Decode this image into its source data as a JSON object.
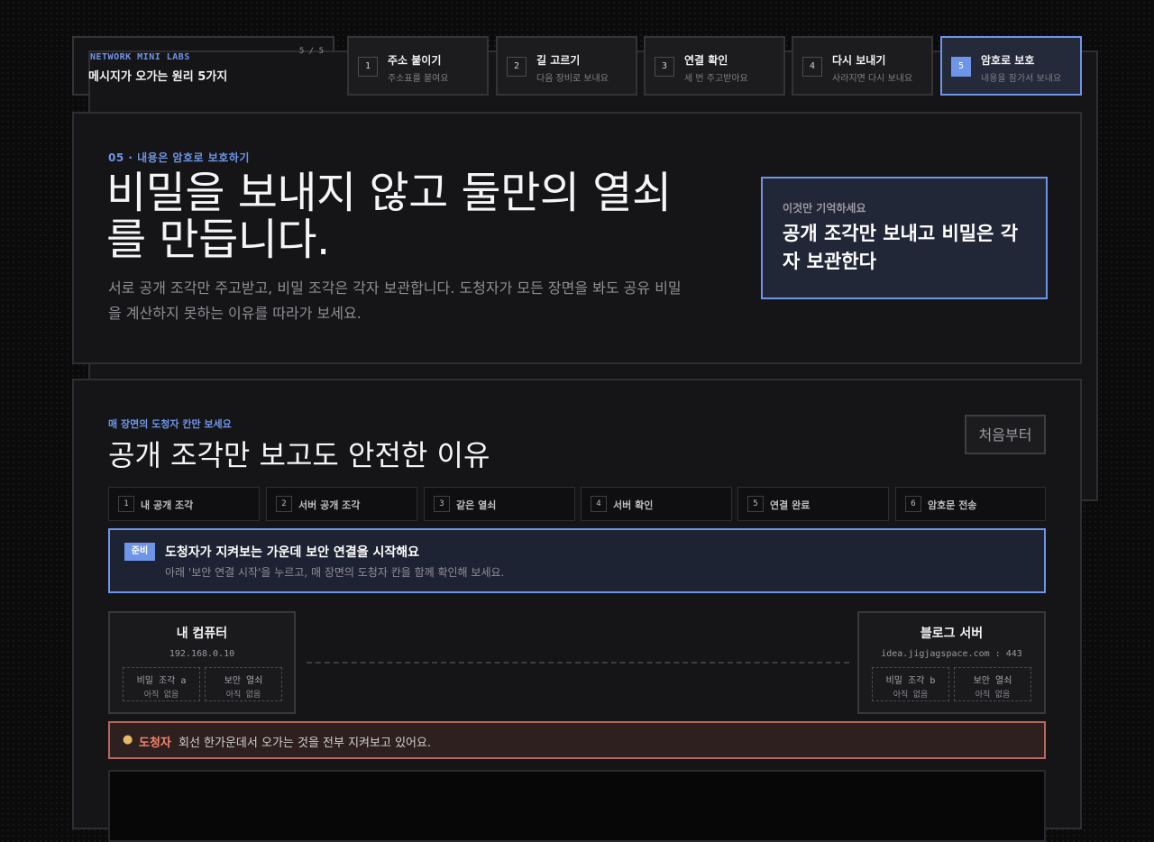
{
  "brand": {
    "lab": "NETWORK MINI LABS",
    "page": "5 / 5",
    "subtitle": "메시지가 오가는 원리 5가지"
  },
  "steps": [
    {
      "num": "1",
      "title": "주소 붙이기",
      "desc": "주소표를 붙여요"
    },
    {
      "num": "2",
      "title": "길 고르기",
      "desc": "다음 장비로 보내요"
    },
    {
      "num": "3",
      "title": "연결 확인",
      "desc": "세 번 주고받아요"
    },
    {
      "num": "4",
      "title": "다시 보내기",
      "desc": "사라지면 다시 보내요"
    },
    {
      "num": "5",
      "title": "암호로 보호",
      "desc": "내용을 잠가서 보내요"
    }
  ],
  "hero": {
    "kicker": "05 · 내용은 암호로 보호하기",
    "title": "비밀을 보내지 않고 둘만의 열쇠를 만듭니다.",
    "desc": "서로 공개 조각만 주고받고, 비밀 조각은 각자 보관합니다. 도청자가 모든 장면을 봐도 공유 비밀을 계산하지 못하는 이유를 따라가 보세요.",
    "remember_label": "이것만 기억하세요",
    "remember_text": "공개 조각만 보내고 비밀은 각자 보관한다"
  },
  "lab": {
    "kicker": "매 장면의 도청자 칸만 보세요",
    "title": "공개 조각만 보고도 안전한 이유",
    "reset_label": "처음부터",
    "tabs": [
      {
        "num": "1",
        "label": "내 공개 조각"
      },
      {
        "num": "2",
        "label": "서버 공개 조각"
      },
      {
        "num": "3",
        "label": "같은 열쇠"
      },
      {
        "num": "4",
        "label": "서버 확인"
      },
      {
        "num": "5",
        "label": "연결 완료"
      },
      {
        "num": "6",
        "label": "암호문 전송"
      }
    ],
    "status": {
      "badge": "준비",
      "title": "도청자가 지켜보는 가운데 보안 연결을 시작해요",
      "hint": "아래 '보안 연결 시작'을 누르고, 매 장면의 도청자 칸을 함께 확인해 보세요."
    },
    "client": {
      "name": "내 컴퓨터",
      "addr": "192.168.0.10",
      "slots": [
        {
          "key": "비밀 조각 a",
          "value": "아직 없음"
        },
        {
          "key": "보안 열쇠",
          "value": "아직 없음"
        }
      ]
    },
    "server": {
      "name": "블로그 서버",
      "addr": "idea.jigjagspace.com : 443",
      "slots": [
        {
          "key": "비밀 조각 b",
          "value": "아직 없음"
        },
        {
          "key": "보안 열쇠",
          "value": "아직 없음"
        }
      ]
    },
    "eavesdropper": {
      "icon": "detective-icon",
      "who": "도청자",
      "message": "회선 한가운데서 오가는 것을 전부 지켜보고 있어요."
    }
  },
  "colors": {
    "accent": "#6f95e8",
    "danger": "#f3856e"
  }
}
